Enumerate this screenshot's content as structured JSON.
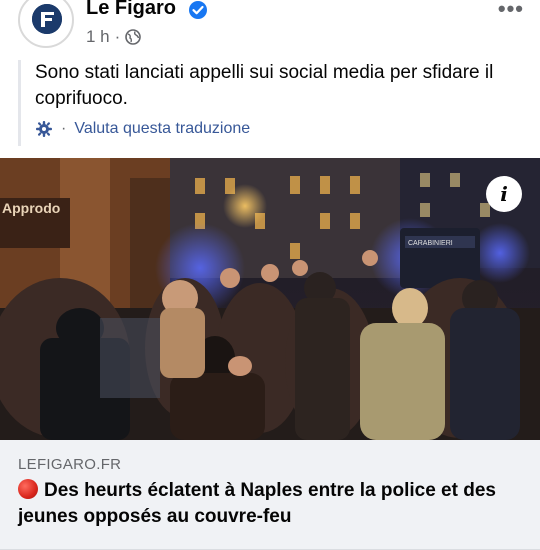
{
  "post": {
    "page_name": "Le Figaro",
    "time": "1 h",
    "separator": "·",
    "text": "Sono stati lanciati appelli sui social media per sfidare il coprifuoco.",
    "translate_separator": "·",
    "translate_label": "Valuta questa traduzione",
    "more_label": "•••"
  },
  "photo": {
    "info_label": "i",
    "sign_text": "Approdo",
    "van_text": "CARABINIERI"
  },
  "link": {
    "domain": "LEFIGARO.FR",
    "headline": "Des heurts éclatent à Naples entre la police et des jeunes opposés au couvre-feu"
  },
  "colors": {
    "link_blue": "#385898",
    "meta_gray": "#65676b",
    "verified_blue": "#1877f2",
    "card_bg": "#f0f2f5",
    "red_emoji": "#d9261c"
  },
  "icons": {
    "avatar_logo": "le-figaro-logo",
    "verified": "verified-badge-icon",
    "privacy": "globe-icon",
    "translate": "gear-icon",
    "info": "info-icon",
    "emoji": "red-circle-emoji"
  }
}
